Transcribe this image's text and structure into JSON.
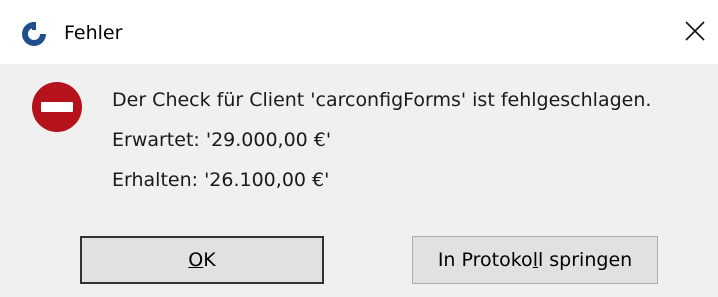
{
  "window": {
    "title": "Fehler"
  },
  "message": {
    "line1": "Der Check für Client 'carconfigForms' ist fehlgeschlagen.",
    "line2": "Erwartet: '29.000,00 €'",
    "line3": "Erhalten: '26.100,00 €'"
  },
  "buttons": {
    "ok": {
      "before": "",
      "mnemonic": "O",
      "after": "K"
    },
    "jump": {
      "before": "In Protoko",
      "mnemonic": "l",
      "after": "l springen"
    }
  },
  "icons": {
    "app": "app-logo-icon",
    "error": "error-stop-icon",
    "close": "close-icon"
  },
  "colors": {
    "error_red": "#b5121b",
    "titlebar_bg": "#ffffff",
    "body_bg": "#f0f0f0",
    "app_icon_blue": "#1f4e8c"
  }
}
